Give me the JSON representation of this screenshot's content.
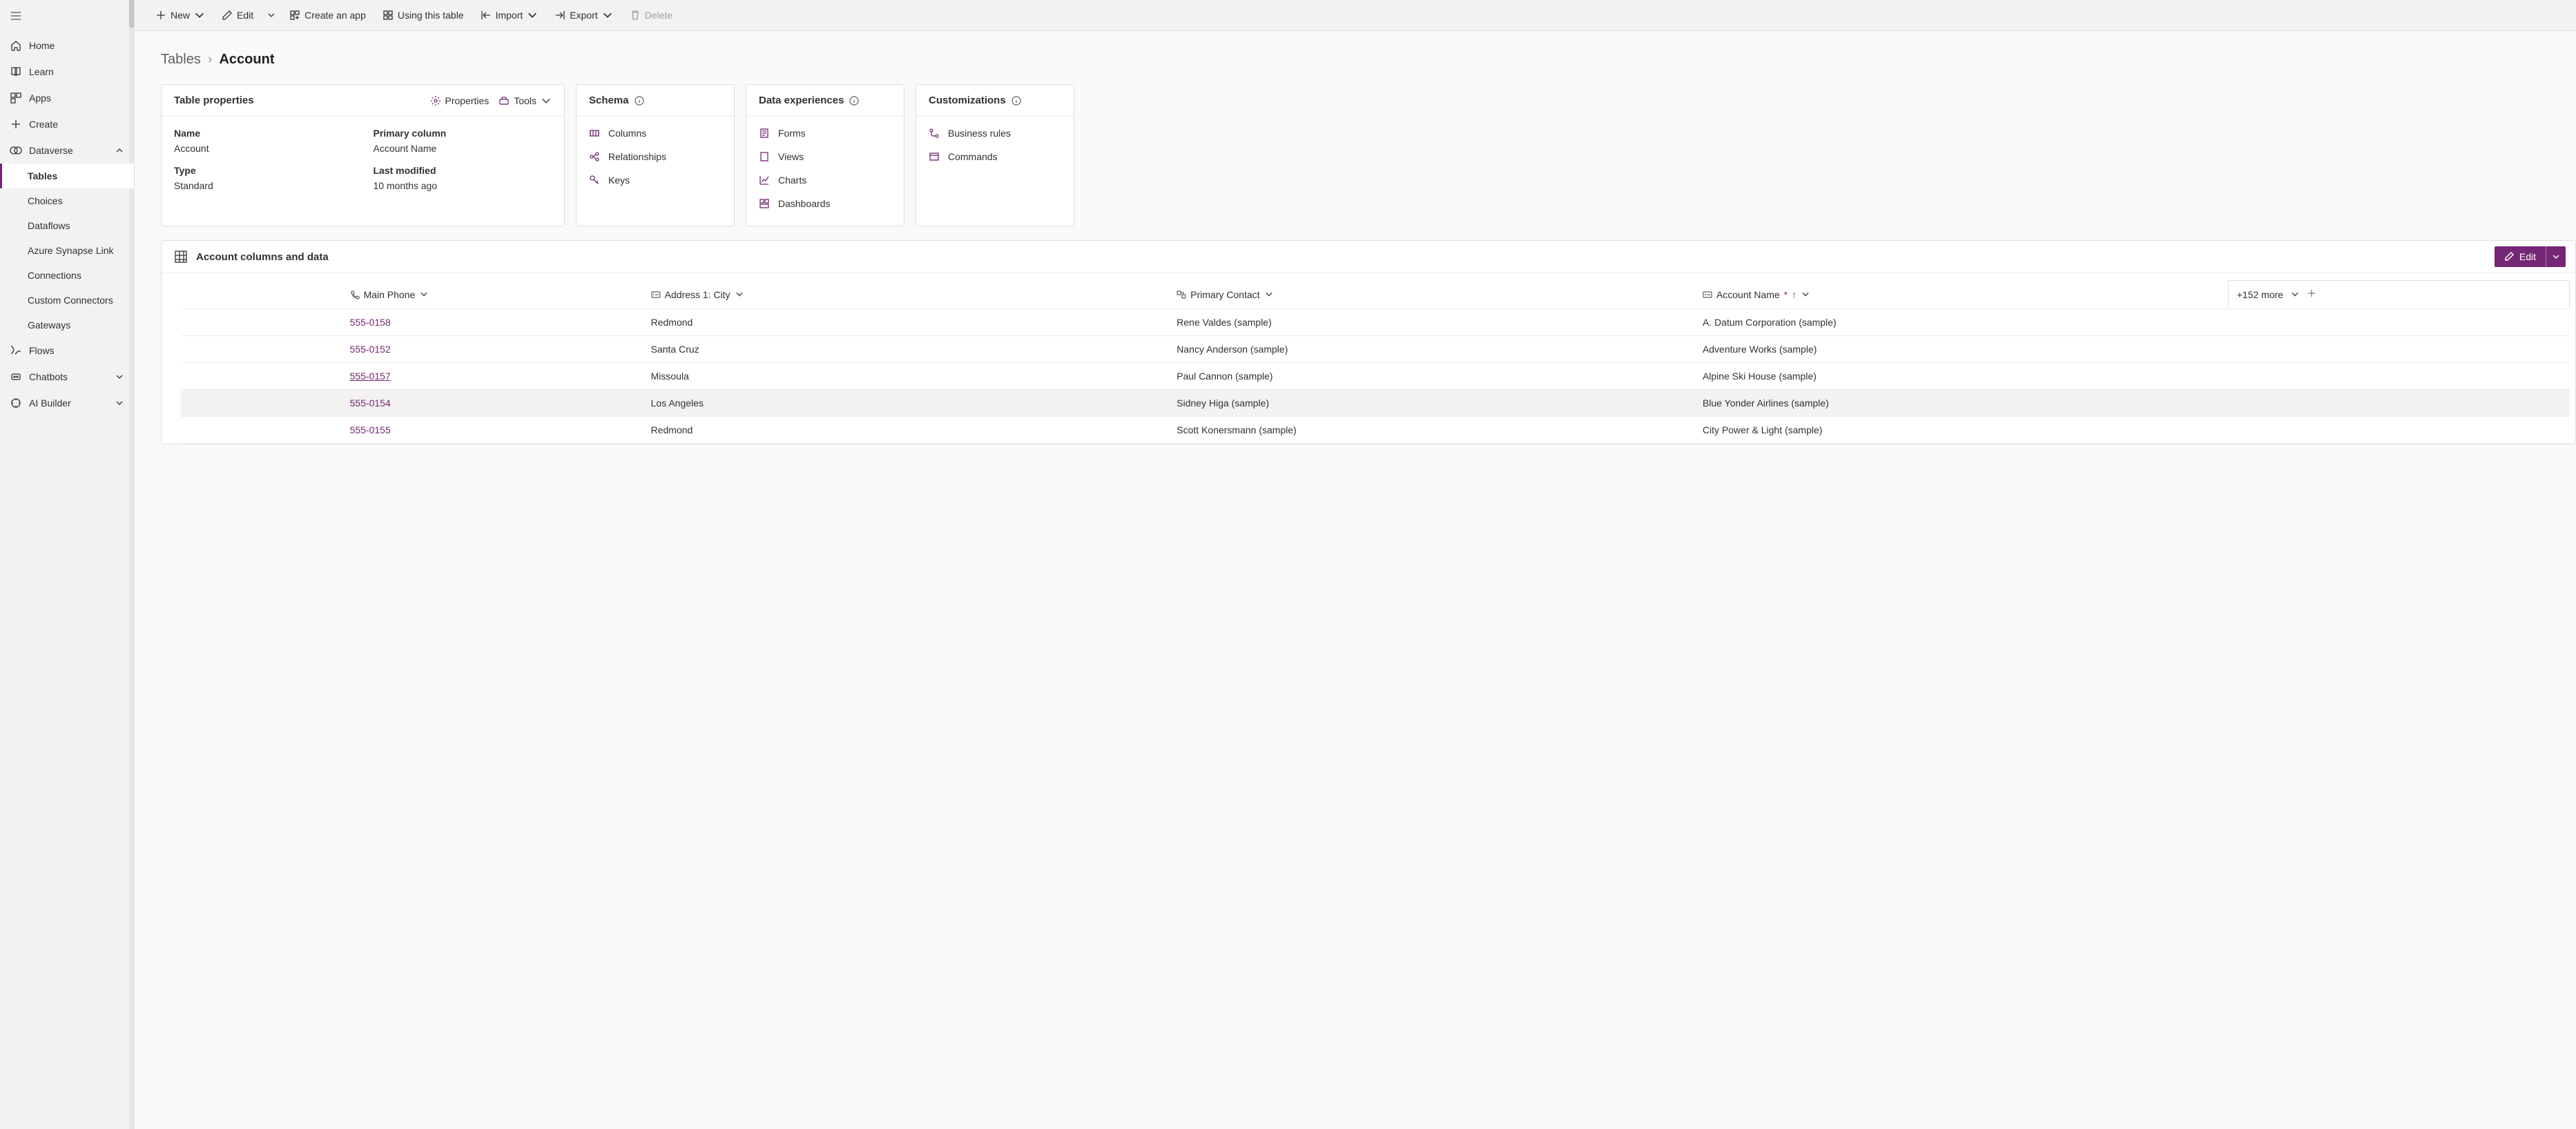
{
  "sidebar": {
    "items": [
      {
        "label": "Home"
      },
      {
        "label": "Learn"
      },
      {
        "label": "Apps"
      },
      {
        "label": "Create"
      },
      {
        "label": "Dataverse"
      },
      {
        "label": "Flows"
      },
      {
        "label": "Chatbots"
      },
      {
        "label": "AI Builder"
      }
    ],
    "sub": [
      {
        "label": "Tables"
      },
      {
        "label": "Choices"
      },
      {
        "label": "Dataflows"
      },
      {
        "label": "Azure Synapse Link"
      },
      {
        "label": "Connections"
      },
      {
        "label": "Custom Connectors"
      },
      {
        "label": "Gateways"
      }
    ]
  },
  "commands": {
    "new": "New",
    "edit": "Edit",
    "create_app": "Create an app",
    "using_table": "Using this table",
    "import": "Import",
    "export": "Export",
    "delete": "Delete"
  },
  "breadcrumb": {
    "parent": "Tables",
    "current": "Account"
  },
  "cards": {
    "properties": {
      "title": "Table properties",
      "actions": {
        "properties": "Properties",
        "tools": "Tools"
      },
      "name_label": "Name",
      "name_value": "Account",
      "type_label": "Type",
      "type_value": "Standard",
      "pcol_label": "Primary column",
      "pcol_value": "Account Name",
      "mod_label": "Last modified",
      "mod_value": "10 months ago"
    },
    "schema": {
      "title": "Schema",
      "columns": "Columns",
      "relationships": "Relationships",
      "keys": "Keys"
    },
    "experiences": {
      "title": "Data experiences",
      "forms": "Forms",
      "views": "Views",
      "charts": "Charts",
      "dashboards": "Dashboards"
    },
    "custom": {
      "title": "Customizations",
      "rules": "Business rules",
      "commands": "Commands"
    }
  },
  "dataSection": {
    "title": "Account columns and data",
    "edit": "Edit",
    "more": "+152 more",
    "columns": {
      "phone": "Main Phone",
      "city": "Address 1: City",
      "contact": "Primary Contact",
      "name": "Account Name"
    },
    "rows": [
      {
        "phone": "555-0158",
        "city": "Redmond",
        "contact": "Rene Valdes (sample)",
        "name": "A. Datum Corporation (sample)"
      },
      {
        "phone": "555-0152",
        "city": "Santa Cruz",
        "contact": "Nancy Anderson (sample)",
        "name": "Adventure Works (sample)"
      },
      {
        "phone": "555-0157",
        "city": "Missoula",
        "contact": "Paul Cannon (sample)",
        "name": "Alpine Ski House (sample)"
      },
      {
        "phone": "555-0154",
        "city": "Los Angeles",
        "contact": "Sidney Higa (sample)",
        "name": "Blue Yonder Airlines (sample)"
      },
      {
        "phone": "555-0155",
        "city": "Redmond",
        "contact": "Scott Konersmann (sample)",
        "name": "City Power & Light (sample)"
      }
    ]
  }
}
